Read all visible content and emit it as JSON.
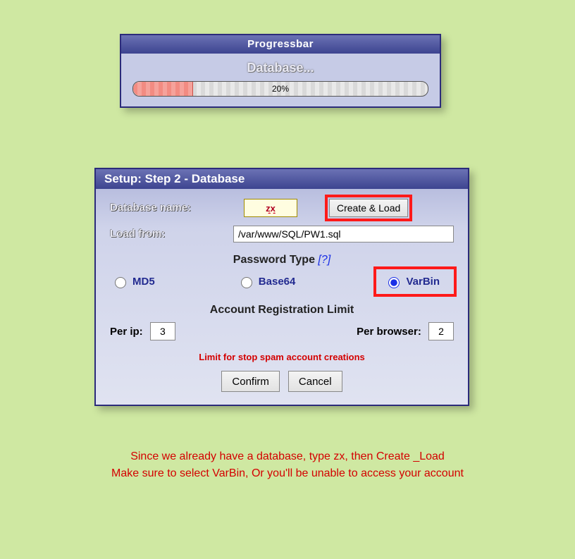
{
  "progress": {
    "title": "Progressbar",
    "label": "Database...",
    "percent_text": "20%",
    "percent_value": 20
  },
  "setup": {
    "title": "Setup: Step 2 - Database",
    "db_name_label": "Database name:",
    "db_name_value": "zx",
    "create_load_label": "Create & Load",
    "load_from_label": "Load from:",
    "load_from_value": "/var/www/SQL/PW1.sql",
    "password_type_title": "Password Type",
    "password_type_help": "[?]",
    "radios": {
      "md5": "MD5",
      "base64": "Base64",
      "varbin": "VarBin",
      "selected": "varbin"
    },
    "reg_limit_title": "Account Registration Limit",
    "per_ip_label": "Per ip:",
    "per_ip_value": "3",
    "per_browser_label": "Per browser:",
    "per_browser_value": "2",
    "spam_note": "Limit for stop spam account creations",
    "confirm_label": "Confirm",
    "cancel_label": "Cancel"
  },
  "annotation": {
    "line1": "Since we already have a database, type zx, then Create _Load",
    "line2": "Make sure to select VarBin, Or you'll be unable to access your account"
  },
  "colors": {
    "page_bg": "#cfe8a2",
    "panel_border": "#2b2b7a",
    "highlight": "#ff1a1a",
    "warning_text": "#d40000",
    "link": "#1a2fe6"
  }
}
